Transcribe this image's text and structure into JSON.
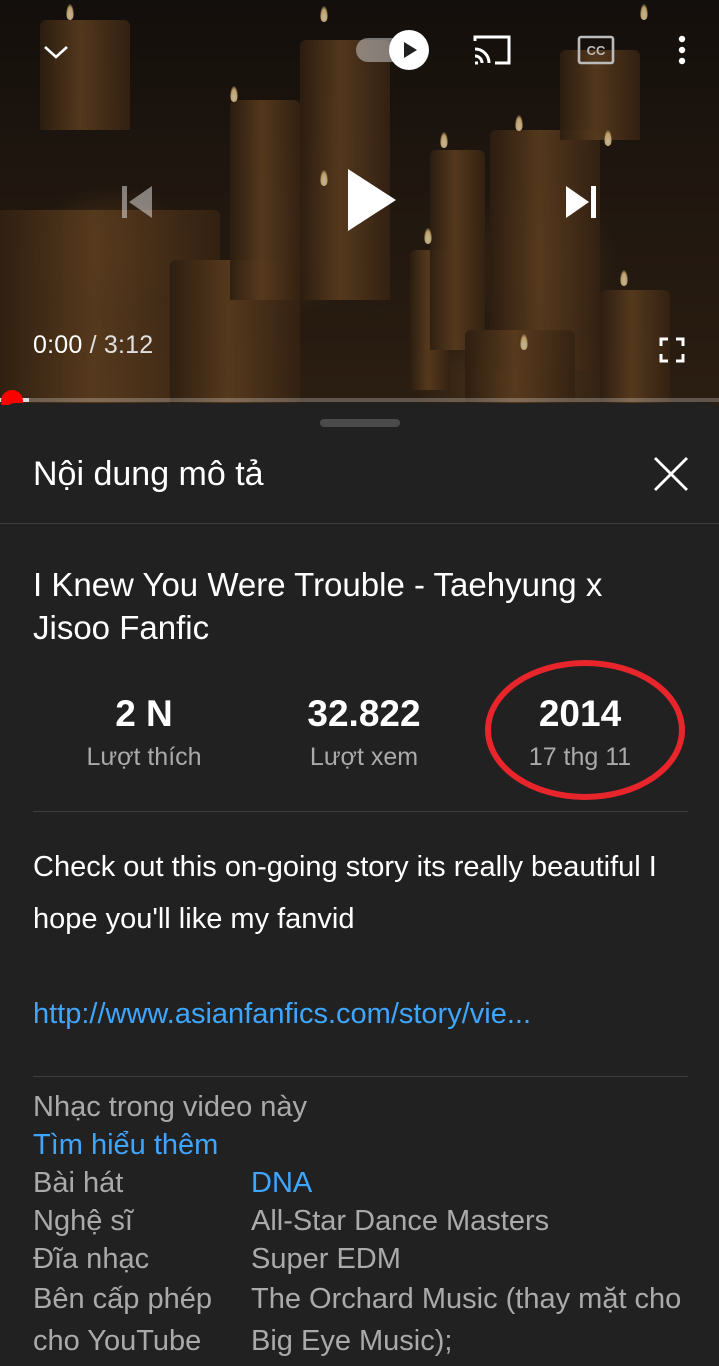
{
  "player": {
    "time_current": "0:00",
    "time_separator": " / ",
    "time_duration": "3:12",
    "progress_buffered": 0.04,
    "progress_played": 0.0
  },
  "panel": {
    "title": "Nội dung mô tả"
  },
  "video": {
    "title": "I Knew You Were Trouble - Taehyung x Jisoo Fanfic",
    "stats": [
      {
        "value": "2 N",
        "label": "Lượt thích"
      },
      {
        "value": "32.822",
        "label": "Lượt xem"
      },
      {
        "value": "2014",
        "label": "17 thg 11"
      }
    ],
    "description": "Check out this on-going story its really beautiful I hope you'll like my fanvid",
    "link": "http://www.asianfanfics.com/story/vie..."
  },
  "music": {
    "heading": "Nhạc trong video này",
    "learn_more": "Tìm hiểu thêm",
    "rows": [
      {
        "key": "Bài hát",
        "value": "DNA"
      },
      {
        "key": "Nghệ sĩ",
        "value": "All-Star Dance Masters"
      },
      {
        "key": "Đĩa nhạc",
        "value": "Super EDM"
      },
      {
        "key": "Bên cấp phép cho YouTube",
        "value": "The Orchard Music (thay mặt cho Big Eye Music);"
      }
    ]
  },
  "colors": {
    "accent_red": "#ff0000",
    "highlight_circle": "#e8252b",
    "link_blue": "#3ea6ff",
    "panel_bg": "#212121"
  },
  "icons": [
    "chevron-down-icon",
    "autoplay-toggle-icon",
    "cast-icon",
    "closed-captions-icon",
    "more-vert-icon",
    "skip-previous-icon",
    "play-icon",
    "skip-next-icon",
    "fullscreen-icon",
    "close-icon"
  ]
}
